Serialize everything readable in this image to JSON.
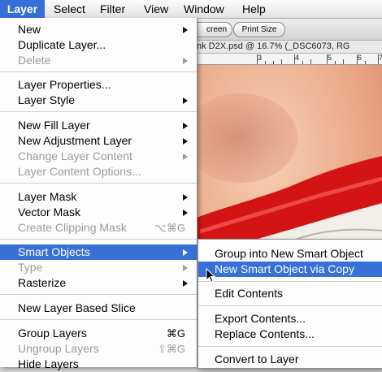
{
  "menubar": {
    "items": [
      {
        "label": "Layer",
        "active": true
      },
      {
        "label": "Select"
      },
      {
        "label": "Filter"
      },
      {
        "label": "View"
      },
      {
        "label": "Window"
      },
      {
        "label": "Help"
      }
    ]
  },
  "options_bar": {
    "screen_button": "creen",
    "print_size_button": "Print Size"
  },
  "document": {
    "title": "nk D2X.psd @ 16.7% (_DSC6073, RG",
    "ruler_numbers": [
      "3",
      "4",
      "5",
      "6",
      "7"
    ]
  },
  "layer_menu": {
    "items": [
      {
        "label": "New",
        "submenu": true
      },
      {
        "label": "Duplicate Layer..."
      },
      {
        "label": "Delete",
        "submenu": true,
        "disabled": true
      },
      {
        "label": "Layer Properties..."
      },
      {
        "label": "Layer Style",
        "submenu": true
      },
      {
        "label": "New Fill Layer",
        "submenu": true
      },
      {
        "label": "New Adjustment Layer",
        "submenu": true
      },
      {
        "label": "Change Layer Content",
        "submenu": true,
        "disabled": true
      },
      {
        "label": "Layer Content Options...",
        "disabled": true
      },
      {
        "label": "Layer Mask",
        "submenu": true
      },
      {
        "label": "Vector Mask",
        "submenu": true
      },
      {
        "label": "Create Clipping Mask",
        "shortcut": "⌥⌘G",
        "disabled": true
      },
      {
        "label": "Smart Objects",
        "submenu": true,
        "selected": true
      },
      {
        "label": "Type",
        "submenu": true,
        "disabled": true
      },
      {
        "label": "Rasterize",
        "submenu": true
      },
      {
        "label": "New Layer Based Slice"
      },
      {
        "label": "Group Layers",
        "shortcut": "⌘G"
      },
      {
        "label": "Ungroup Layers",
        "shortcut": "⇧⌘G",
        "disabled": true
      },
      {
        "label": "Hide Layers"
      }
    ]
  },
  "smart_objects_submenu": {
    "items": [
      {
        "label": "Group into New Smart Object"
      },
      {
        "label": "New Smart Object via Copy",
        "selected": true
      },
      {
        "label": "Edit Contents"
      },
      {
        "label": "Export Contents..."
      },
      {
        "label": "Replace Contents..."
      },
      {
        "label": "Convert to Layer"
      }
    ]
  },
  "colors": {
    "highlight": "#3770d6",
    "lip_red": "#d41414"
  },
  "icons": {
    "submenu_arrow": "triangle-right-icon",
    "cursor": "arrow-cursor-icon"
  }
}
